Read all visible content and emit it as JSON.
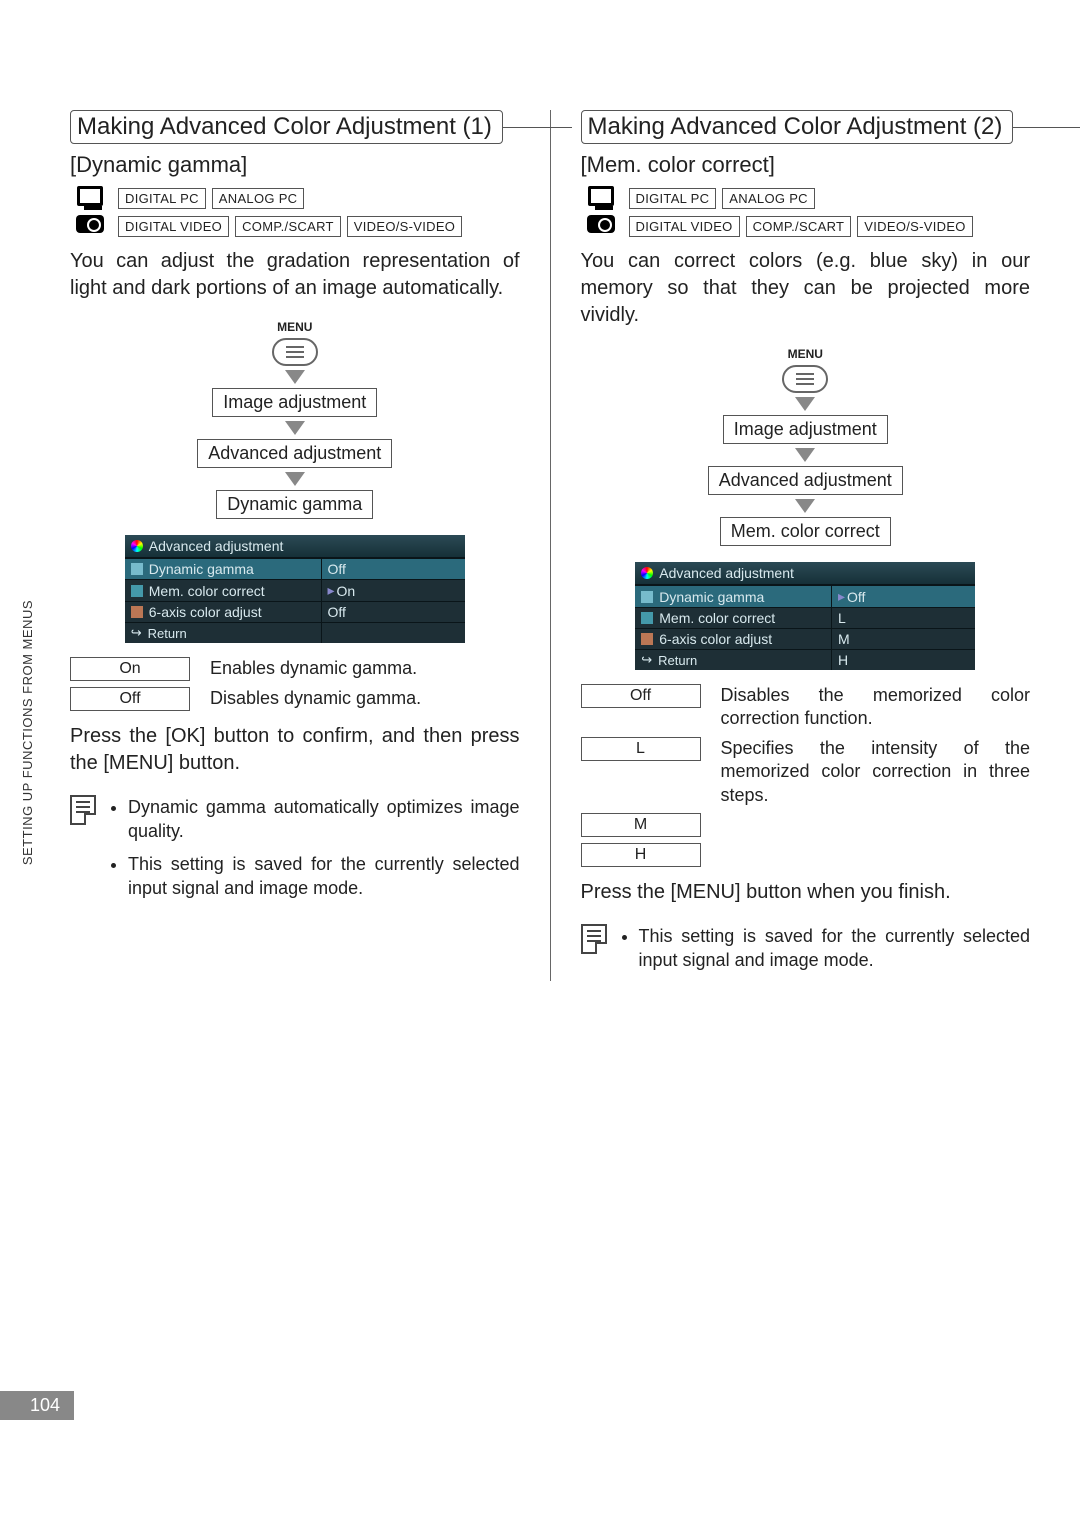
{
  "page_number": "104",
  "side_tab": "SETTING UP FUNCTIONS FROM MENUS",
  "menu_label": "MENU",
  "flow_steps": [
    "Image adjustment",
    "Advanced adjustment"
  ],
  "badges_pc": [
    "DIGITAL PC",
    "ANALOG PC"
  ],
  "badges_vid": [
    "DIGITAL VIDEO",
    "COMP./SCART",
    "VIDEO/S-VIDEO"
  ],
  "osd_title": "Advanced adjustment",
  "osd_return": "Return",
  "left": {
    "title": "Making Advanced Color Adjustment (1)",
    "subhead": "[Dynamic gamma]",
    "body": "You can adjust the gradation representation of light and dark portions of an image automatically.",
    "flow_final": "Dynamic gamma",
    "osd_rows": [
      {
        "label": "Dynamic gamma",
        "value": "Off",
        "selected": true
      },
      {
        "label": "Mem. color correct",
        "value": "On",
        "caret": true,
        "selected": false
      },
      {
        "label": "6-axis color adjust",
        "value": "Off",
        "selected": false
      }
    ],
    "options": [
      {
        "label": "On",
        "desc": "Enables dynamic gamma."
      },
      {
        "label": "Off",
        "desc": "Disables dynamic gamma."
      }
    ],
    "after": "Press the [OK] button to confirm, and then press the [MENU] button.",
    "notes": [
      "Dynamic gamma automatically optimizes image quality.",
      "This setting is saved for the currently selected input signal and image mode."
    ]
  },
  "right": {
    "title": "Making Advanced Color Adjustment (2)",
    "subhead": "[Mem. color correct]",
    "body": "You can correct colors (e.g. blue sky) in our memory so that they can be projected more vividly.",
    "flow_final": "Mem. color correct",
    "osd_rows": [
      {
        "label": "Dynamic gamma",
        "value": "Off",
        "caret": true,
        "selected": true
      },
      {
        "label": "Mem. color correct",
        "value": "L",
        "selected": false
      },
      {
        "label": "6-axis color adjust",
        "value": "M",
        "selected": false
      },
      {
        "label_extra_value_row": true,
        "value": "H"
      }
    ],
    "options": [
      {
        "label": "Off",
        "desc": "Disables the memorized color correction function."
      },
      {
        "label": "L",
        "desc": "Specifies the intensity of the memorized color correction in three steps."
      },
      {
        "label": "M",
        "desc": ""
      },
      {
        "label": "H",
        "desc": ""
      }
    ],
    "after": "Press the [MENU] button when you finish.",
    "notes": [
      "This setting is saved for the currently selected input signal and image mode."
    ]
  }
}
